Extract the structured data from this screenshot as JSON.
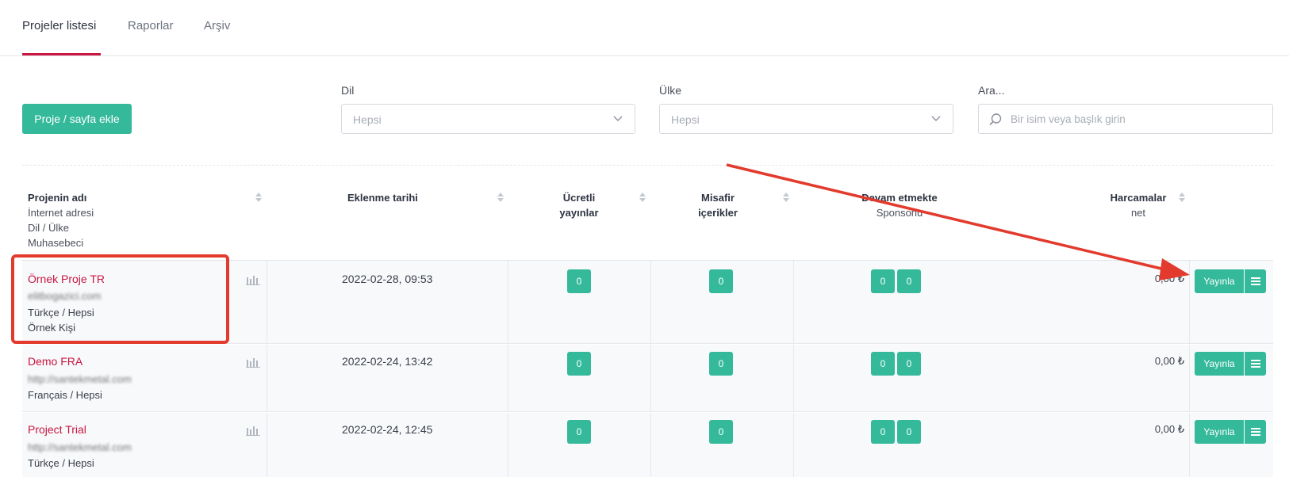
{
  "tabs": [
    {
      "label": "Projeler listesi",
      "active": true
    },
    {
      "label": "Raporlar",
      "active": false
    },
    {
      "label": "Arşiv",
      "active": false
    }
  ],
  "toolbar": {
    "add_label": "Proje / sayfa ekle",
    "language_label": "Dil",
    "language_value": "Hepsi",
    "country_label": "Ülke",
    "country_value": "Hepsi",
    "search_label": "Ara...",
    "search_placeholder": "Bir isim veya başlık girin"
  },
  "table": {
    "headers": {
      "name": "Projenin adı",
      "name_sub1": "İnternet adresi",
      "name_sub2": "Dil / Ülke",
      "name_sub3": "Muhasebeci",
      "date": "Eklenme tarihi",
      "paid1": "Ücretli",
      "paid2": "yayınlar",
      "guest1": "Misafir",
      "guest2": "içerikler",
      "ongoing": "Devam etmekte",
      "ongoing_sub": "Sponsorlu",
      "spend": "Harcamalar",
      "spend_sub": "net"
    },
    "rows": [
      {
        "name": "Örnek Proje TR",
        "url": "elitbogazici.com",
        "lang": "Türkçe / Hepsi",
        "accountant": "Örnek Kişi",
        "date": "2022-02-28, 09:53",
        "paid": "0",
        "guest": "0",
        "ongoing": "0",
        "sponsored": "0",
        "amount": "0,00 ₺",
        "publish": "Yayınla"
      },
      {
        "name": "Demo FRA",
        "url": "http://santekmetal.com",
        "lang": "Français / Hepsi",
        "accountant": "",
        "date": "2022-02-24, 13:42",
        "paid": "0",
        "guest": "0",
        "ongoing": "0",
        "sponsored": "0",
        "amount": "0,00 ₺",
        "publish": "Yayınla"
      },
      {
        "name": "Project Trial",
        "url": "http://santekmetal.com",
        "lang": "Türkçe / Hepsi",
        "accountant": "",
        "date": "2022-02-24, 12:45",
        "paid": "0",
        "guest": "0",
        "ongoing": "0",
        "sponsored": "0",
        "amount": "0,00 ₺",
        "publish": "Yayınla"
      }
    ]
  },
  "colors": {
    "accent": "#35b99b",
    "brand": "#c8163f",
    "annotation": "#e23a2c"
  }
}
